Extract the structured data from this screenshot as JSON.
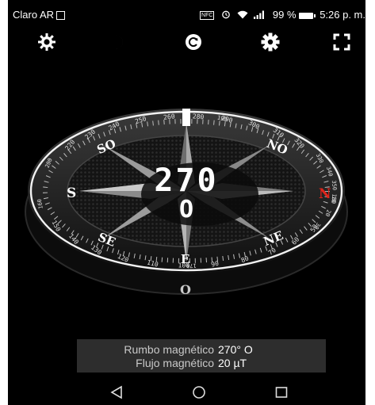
{
  "status_bar": {
    "carrier": "Claro AR",
    "nfc": "NFC",
    "battery": "99 %",
    "time": "5:26 p. m."
  },
  "toolbar": {
    "icons": [
      "brightness-icon",
      "night-mode-icon",
      "calibrate-icon",
      "settings-icon",
      "fullscreen-icon"
    ]
  },
  "compass": {
    "heading_degrees": "270",
    "heading_direction": "O",
    "cardinals": {
      "west": "S",
      "east": "N",
      "north": "NO",
      "northwest": "SO",
      "southwest": "SE",
      "southeast": "NE",
      "south_marker": "E",
      "bottom_marker": "O"
    },
    "scale_labels_top": [
      "220",
      "230",
      "240",
      "250",
      "260",
      "280",
      "290",
      "300",
      "310",
      "320"
    ],
    "scale_labels_left": [
      "200",
      "190",
      "180",
      "170",
      "160"
    ],
    "scale_labels_right": [
      "330",
      "340",
      "350",
      "10",
      "20",
      "30"
    ],
    "scale_labels_bottom": [
      "150",
      "140",
      "130",
      "120",
      "110",
      "100",
      "90",
      "80",
      "70",
      "60",
      "50"
    ],
    "colors": {
      "north_marker": "#e0241b",
      "ring": "#ffffff",
      "background": "#000000"
    }
  },
  "info": {
    "heading_label": "Rumbo magnético",
    "heading_value": "270° O",
    "flux_label": "Flujo magnético",
    "flux_value": "20 µT"
  },
  "nav_bar": {
    "icons": [
      "back-icon",
      "home-icon",
      "recents-icon"
    ]
  }
}
